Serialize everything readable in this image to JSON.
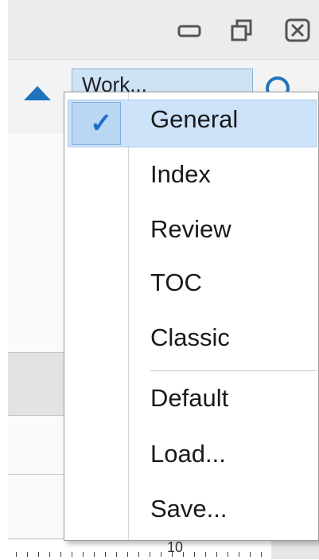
{
  "window": {
    "icons": [
      "minimize-icon",
      "restore-icon",
      "close-icon"
    ]
  },
  "toolbar": {
    "layout_combo_text": "Work..."
  },
  "ruler": {
    "number": "10"
  },
  "menu": {
    "items": [
      {
        "label": "General",
        "checked": true
      },
      {
        "label": "Index",
        "checked": false
      },
      {
        "label": "Review",
        "checked": false
      },
      {
        "label": "TOC",
        "checked": false
      },
      {
        "label": "Classic",
        "checked": false
      },
      {
        "label": "Default",
        "checked": false
      },
      {
        "label": "Load...",
        "checked": false
      },
      {
        "label": "Save...",
        "checked": false
      }
    ],
    "check_glyph": "✓"
  },
  "colors": {
    "accent": "#1e73be",
    "highlight": "#cde3f9"
  }
}
